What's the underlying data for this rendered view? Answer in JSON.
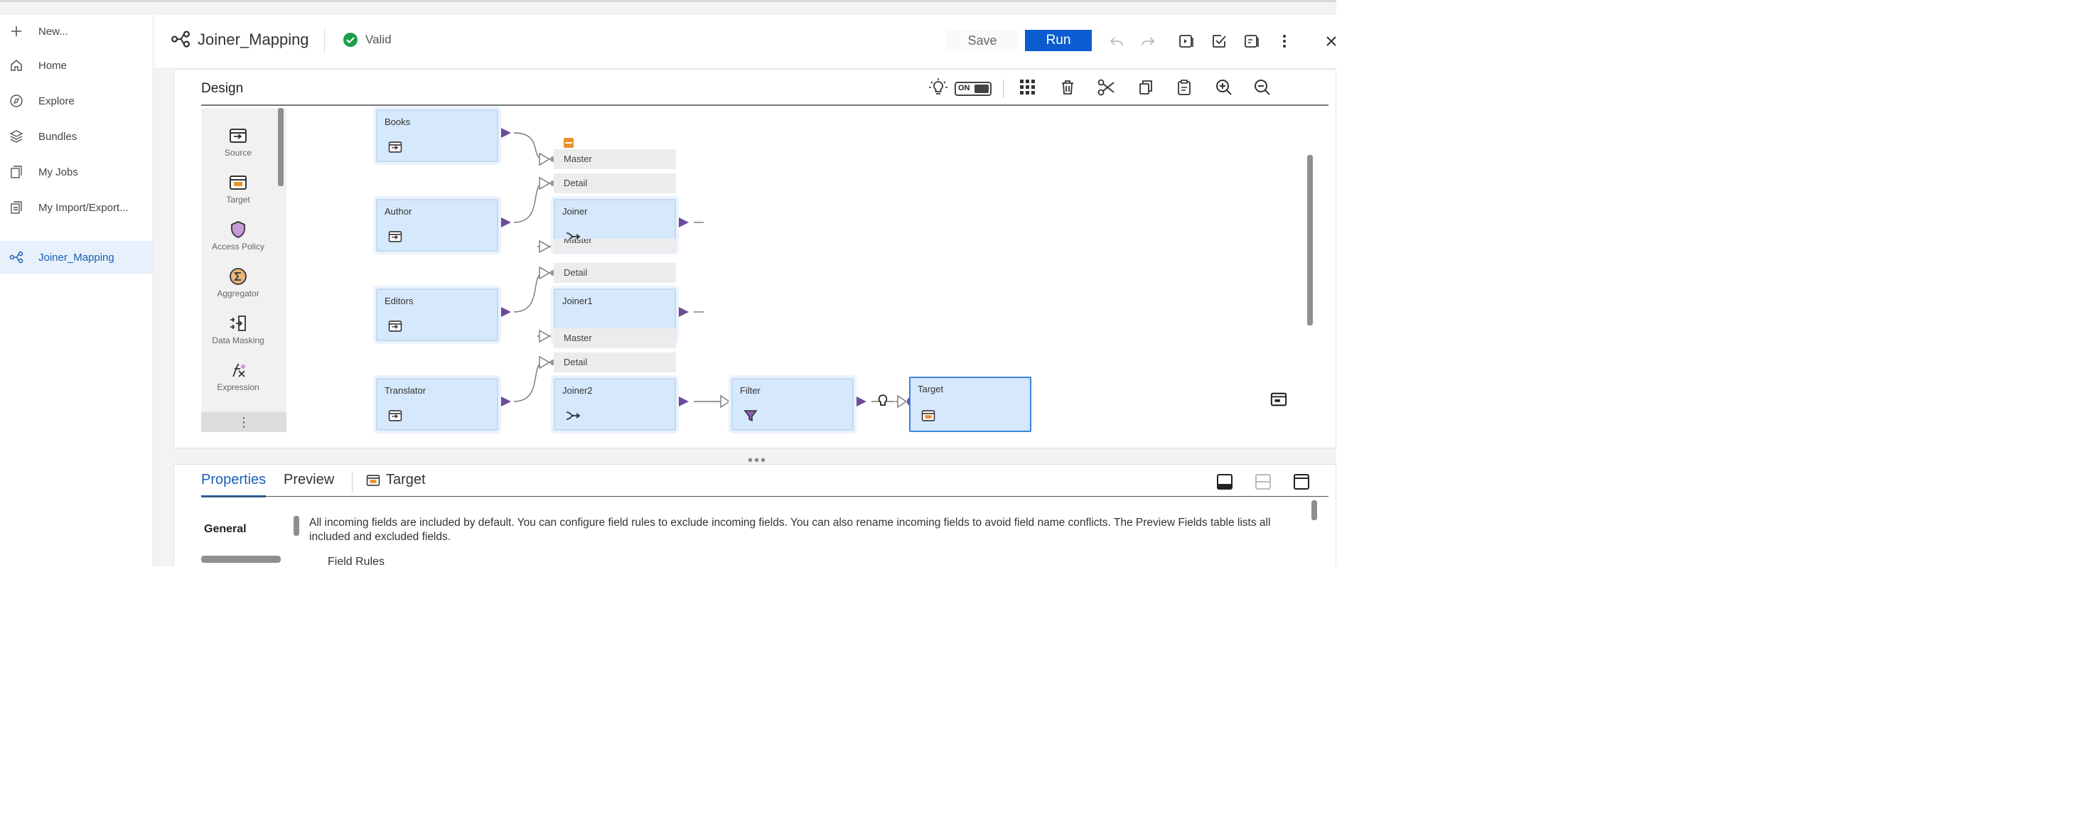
{
  "sidebar": {
    "items": [
      {
        "label": "New...",
        "icon": "plus-icon"
      },
      {
        "label": "Home",
        "icon": "home-icon"
      },
      {
        "label": "Explore",
        "icon": "compass-icon"
      },
      {
        "label": "Bundles",
        "icon": "layers-icon"
      },
      {
        "label": "My Jobs",
        "icon": "jobs-icon"
      },
      {
        "label": "My Import/Export...",
        "icon": "import-export-icon"
      },
      {
        "label": "Joiner_Mapping",
        "icon": "mapping-icon",
        "active": true
      }
    ]
  },
  "header": {
    "title": "Joiner_Mapping",
    "status": "Valid",
    "save_label": "Save",
    "run_label": "Run"
  },
  "design": {
    "title": "Design",
    "toggle_label": "ON"
  },
  "palette": {
    "items": [
      {
        "label": "Source",
        "icon": "source-icon"
      },
      {
        "label": "Target",
        "icon": "target-icon"
      },
      {
        "label": "Access Policy",
        "icon": "shield-icon"
      },
      {
        "label": "Aggregator",
        "icon": "sigma-icon"
      },
      {
        "label": "Data Masking",
        "icon": "masking-icon"
      },
      {
        "label": "Expression",
        "icon": "expression-icon"
      }
    ],
    "more": "⋮"
  },
  "canvas": {
    "sources": [
      "Books",
      "Author",
      "Editors",
      "Translator"
    ],
    "joiners": [
      "Joiner",
      "Joiner1",
      "Joiner2"
    ],
    "port_master": "Master",
    "port_detail": "Detail",
    "filter": "Filter",
    "target": "Target"
  },
  "props": {
    "tabs": [
      "Properties",
      "Preview"
    ],
    "target_label": "Target",
    "general": "General",
    "description": "All incoming fields are included by default. You can configure field rules to exclude incoming fields. You can also rename incoming fields to avoid field name conflicts. The Preview Fields table lists all included and excluded fields.",
    "field_rules": "Field Rules"
  },
  "colors": {
    "accent": "#0b5cd0",
    "node_fill": "#d6e8fb",
    "port_purple": "#6b4c9a",
    "valid_green": "#1e9e4a"
  }
}
